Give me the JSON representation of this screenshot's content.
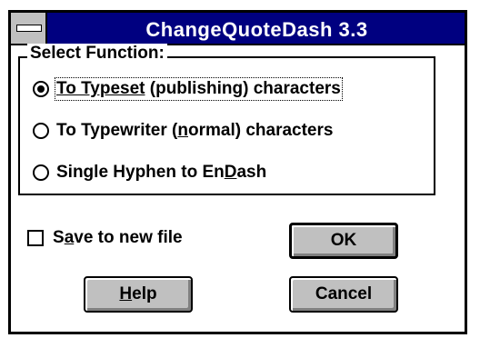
{
  "window": {
    "title": "ChangeQuoteDash 3.3",
    "system_menu_icon": "system-menu-icon"
  },
  "group": {
    "label": "Select Function:",
    "options": [
      {
        "label_pre": "",
        "label_u": "To Typeset",
        "label_post": " (publishing) characters",
        "checked": true
      },
      {
        "label_pre": "To Typewriter (",
        "label_u": "n",
        "label_post": "ormal) characters",
        "checked": false
      },
      {
        "label_pre": "Single Hyphen to En",
        "label_u": "D",
        "label_post": "ash",
        "checked": false
      }
    ]
  },
  "save_checkbox": {
    "label_pre": "S",
    "label_u": "a",
    "label_post": "ve to new file",
    "checked": false
  },
  "buttons": {
    "ok": "OK",
    "help_u": "H",
    "help_post": "elp",
    "cancel": "Cancel"
  }
}
